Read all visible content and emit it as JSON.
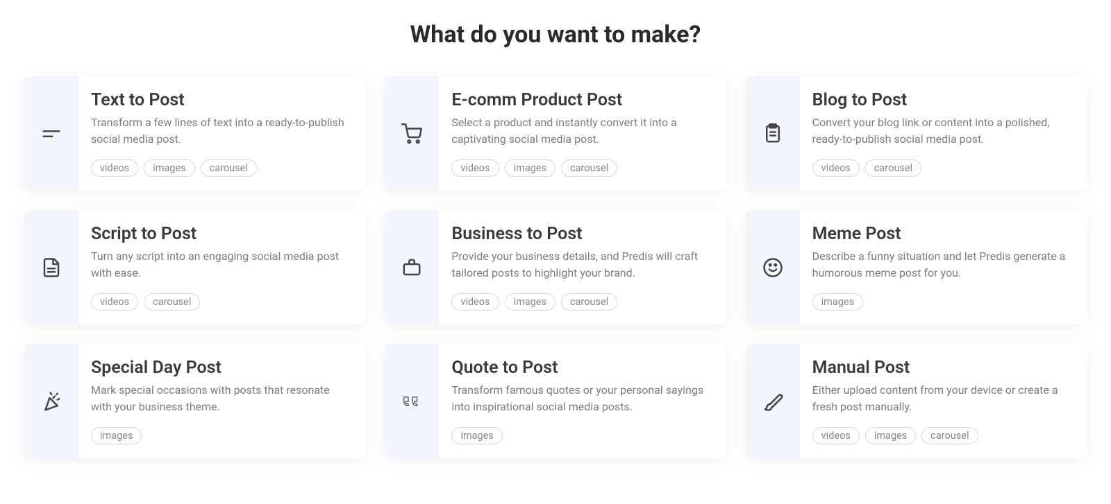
{
  "heading": "What do you want to make?",
  "cards": [
    {
      "icon": "text",
      "title": "Text to Post",
      "description": "Transform a few lines of text into a ready-to-publish social media post.",
      "tags": [
        "videos",
        "images",
        "carousel"
      ]
    },
    {
      "icon": "cart",
      "title": "E-comm Product Post",
      "description": "Select a product and instantly convert it into a captivating social media post.",
      "tags": [
        "videos",
        "images",
        "carousel"
      ]
    },
    {
      "icon": "clipboard",
      "title": "Blog to Post",
      "description": "Convert your blog link or content into a polished, ready-to-publish social media post.",
      "tags": [
        "videos",
        "carousel"
      ]
    },
    {
      "icon": "document",
      "title": "Script to Post",
      "description": "Turn any script into an engaging social media post with ease.",
      "tags": [
        "videos",
        "carousel"
      ]
    },
    {
      "icon": "briefcase",
      "title": "Business to Post",
      "description": "Provide your business details, and Predis will craft tailored posts to highlight your brand.",
      "tags": [
        "videos",
        "images",
        "carousel"
      ]
    },
    {
      "icon": "smile",
      "title": "Meme Post",
      "description": "Describe a funny situation and let Predis generate a humorous meme post for you.",
      "tags": [
        "images"
      ]
    },
    {
      "icon": "party",
      "title": "Special Day Post",
      "description": "Mark special occasions with posts that resonate with your business theme.",
      "tags": [
        "images"
      ]
    },
    {
      "icon": "quote",
      "title": "Quote to Post",
      "description": "Transform famous quotes or your personal sayings into inspirational social media posts.",
      "tags": [
        "images"
      ]
    },
    {
      "icon": "brush",
      "title": "Manual Post",
      "description": "Either upload content from your device or create a fresh post manually.",
      "tags": [
        "videos",
        "images",
        "carousel"
      ]
    }
  ]
}
